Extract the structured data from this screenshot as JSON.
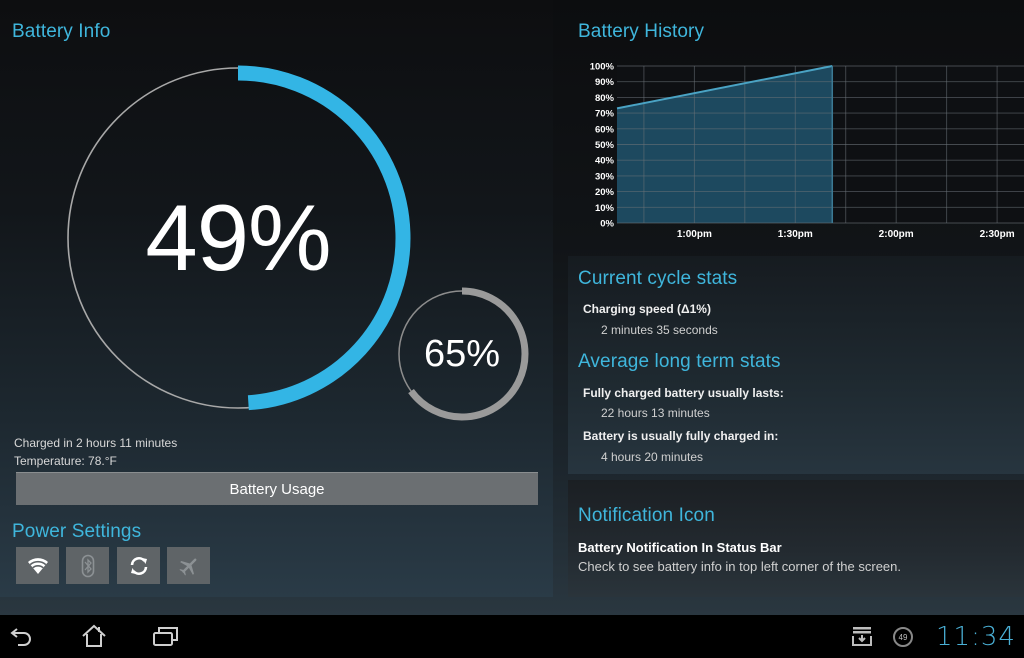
{
  "battery_info": {
    "title": "Battery Info",
    "level_percent": 49,
    "level_label": "49%",
    "secondary_percent": 65,
    "secondary_label": "65%",
    "charged_in": "Charged in 2 hours 11 minutes",
    "temperature": "Temperature: 78.°F",
    "usage_button": "Battery Usage",
    "colors": {
      "primary_arc": "#33b5e5",
      "secondary_arc": "#9a9a9a",
      "ring": "#b0b0b0"
    }
  },
  "power_settings": {
    "title": "Power Settings",
    "toggles": [
      {
        "name": "wifi",
        "icon": "wifi-icon",
        "on": true
      },
      {
        "name": "bluetooth",
        "icon": "bluetooth-icon",
        "on": false
      },
      {
        "name": "sync",
        "icon": "sync-icon",
        "on": true
      },
      {
        "name": "airplane",
        "icon": "airplane-icon",
        "on": false
      }
    ]
  },
  "battery_history": {
    "title": "Battery History"
  },
  "chart_data": {
    "type": "area",
    "title": "Battery History",
    "xlabel": "",
    "ylabel": "",
    "x_unit": "minutes after 12:00pm",
    "x": [
      37,
      101
    ],
    "values": [
      73,
      100
    ],
    "xlim": [
      37,
      158
    ],
    "ylim": [
      0,
      100
    ],
    "yticks": [
      0,
      10,
      20,
      30,
      40,
      50,
      60,
      70,
      80,
      90,
      100
    ],
    "ytick_labels": [
      "0%",
      "10%",
      "20%",
      "30%",
      "40%",
      "50%",
      "60%",
      "70%",
      "80%",
      "90%",
      "100%"
    ],
    "x_gridlines": [
      45,
      60,
      75,
      90,
      105,
      120,
      135,
      150
    ],
    "xticks": [
      60,
      90,
      120,
      150
    ],
    "xtick_labels": [
      "1:00pm",
      "1:30pm",
      "2:00pm",
      "2:30pm"
    ],
    "grid": true,
    "fill_color": "#1f4d63",
    "line_color": "#4aa3c4"
  },
  "current_cycle": {
    "title": "Current cycle stats",
    "items": [
      {
        "label": "Charging speed (Δ1%)",
        "value": "2 minutes 35 seconds"
      }
    ]
  },
  "long_term": {
    "title": "Average long term stats",
    "items": [
      {
        "label": "Fully charged battery usually lasts:",
        "value": "22 hours 13 minutes"
      },
      {
        "label": "Battery is usually fully charged in:",
        "value": "4 hours 20 minutes"
      }
    ]
  },
  "notification": {
    "title": "Notification Icon",
    "setting_title": "Battery Notification In Status Bar",
    "setting_desc": "Check to see battery info in top left corner of the screen."
  },
  "navbar": {
    "battery_badge": "49",
    "clock": "11:34"
  }
}
